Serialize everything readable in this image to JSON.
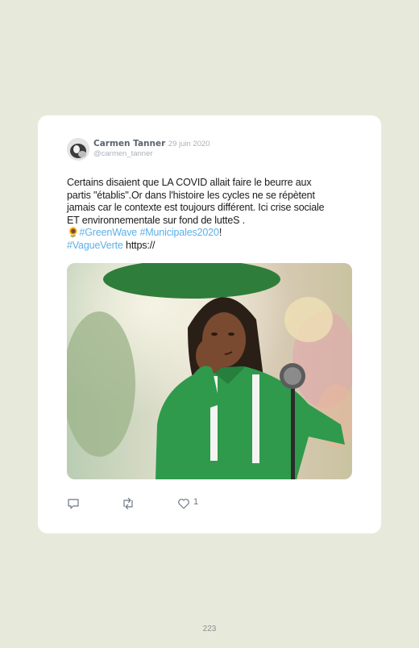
{
  "author": {
    "name": "Carmen Tanner",
    "date": "· 29 juin 2020",
    "handle": "@carmen_tanner"
  },
  "tweet": {
    "line1": "Certains disaient que LA COVID allait faire le beurre aux",
    "line2": "partis \"établis\".Or dans l'histoire les cycles ne se répètent",
    "line3": "jamais car le contexte est toujours différent. Ici crise sociale",
    "line4": "ET environnementale sur fond de lutteS .",
    "emoji": "🌻",
    "hashtag1": "#GreenWave",
    "hashtag2": "#Municipales2020",
    "exclaim": "!",
    "hashtag3": "#VagueVerte",
    "link": " https://"
  },
  "actions": {
    "reply_icon": "reply-icon",
    "retweet_icon": "retweet-icon",
    "like_icon": "heart-icon",
    "like_count": "1"
  },
  "colors": {
    "page_background": "#e7eadb",
    "card_background": "#ffffff",
    "hashtag": "#5ab0e6",
    "muted": "#a9b1ba"
  },
  "page_number": "223"
}
